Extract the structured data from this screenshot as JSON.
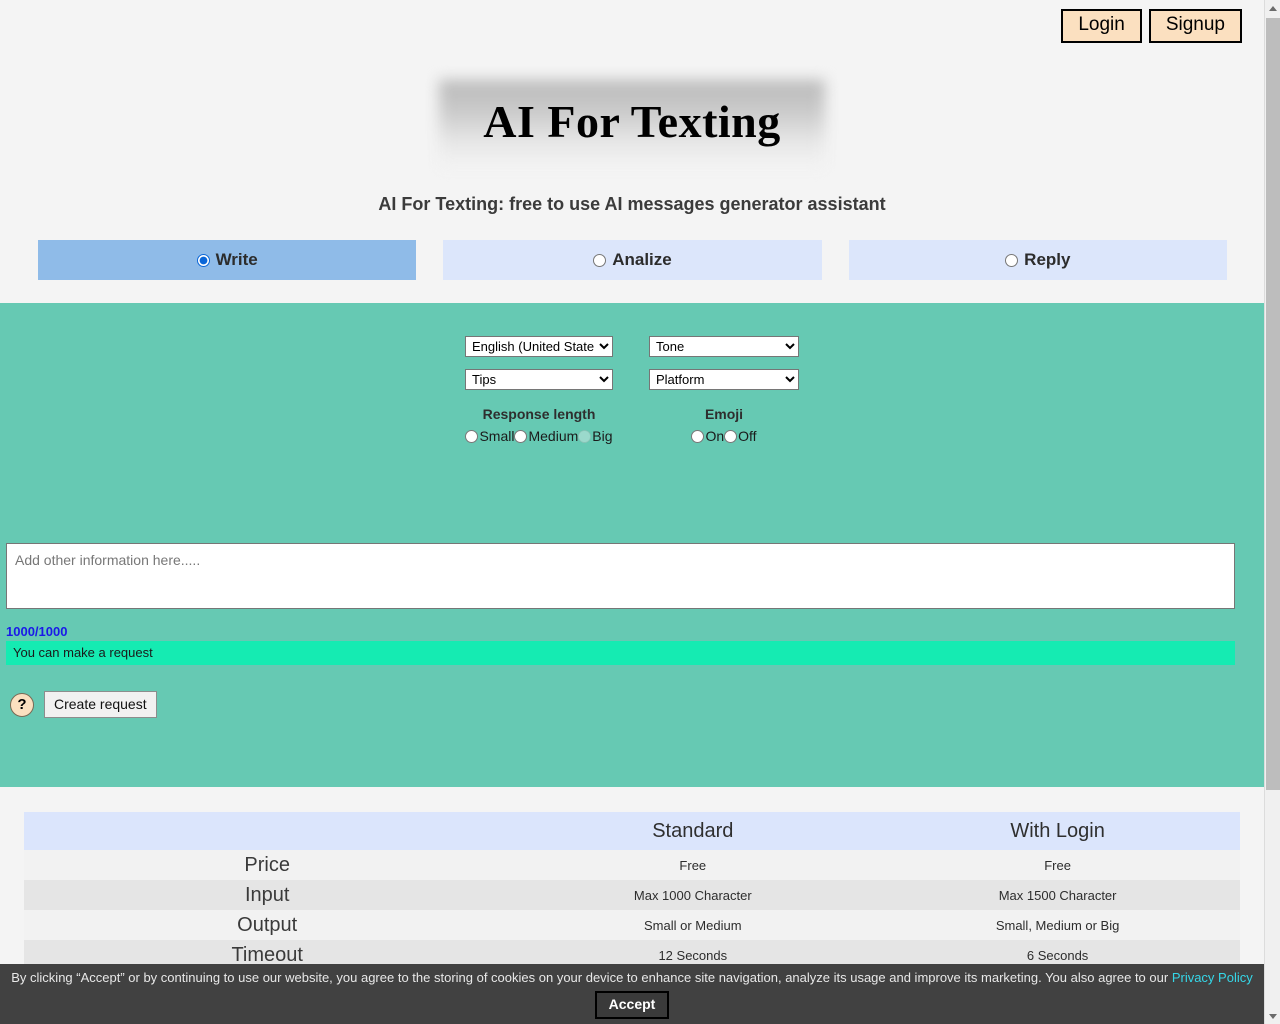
{
  "auth": {
    "login_label": "Login",
    "signup_label": "Signup"
  },
  "hero": {
    "title": "AI For Texting",
    "subtitle": "AI For Texting: free to use AI messages generator assistant"
  },
  "tabs": [
    {
      "label": "Write",
      "selected": true,
      "name": "tab-write"
    },
    {
      "label": "Analize",
      "selected": false,
      "name": "tab-analize"
    },
    {
      "label": "Reply",
      "selected": false,
      "name": "tab-reply"
    }
  ],
  "form": {
    "language_select": {
      "value": "English (United States)",
      "options": [
        "English (United States)"
      ]
    },
    "tone_select": {
      "value": "Tone",
      "options": [
        "Tone"
      ]
    },
    "tips_select": {
      "value": "Tips",
      "options": [
        "Tips"
      ]
    },
    "platform_select": {
      "value": "Platform",
      "options": [
        "Platform"
      ]
    },
    "response_length": {
      "title": "Response length",
      "options": [
        {
          "label": "Small",
          "selected": false,
          "disabled": false
        },
        {
          "label": "Medium",
          "selected": false,
          "disabled": false
        },
        {
          "label": "Big",
          "selected": false,
          "disabled": true
        }
      ]
    },
    "emoji": {
      "title": "Emoji",
      "options": [
        {
          "label": "On",
          "selected": false,
          "disabled": false
        },
        {
          "label": "Off",
          "selected": false,
          "disabled": false
        }
      ]
    },
    "textarea": {
      "placeholder": "Add other information here.....",
      "value": ""
    },
    "counter": "1000/1000",
    "status": "You can make a request",
    "help_icon_glyph": "?",
    "create_button": "Create request"
  },
  "comparison": {
    "headers": [
      "",
      "Standard",
      "With Login"
    ],
    "rows": [
      {
        "feature": "Price",
        "standard": "Free",
        "with_login": "Free"
      },
      {
        "feature": "Input",
        "standard": "Max 1000 Character",
        "with_login": "Max 1500 Character"
      },
      {
        "feature": "Output",
        "standard": "Small or Medium",
        "with_login": "Small, Medium or Big"
      },
      {
        "feature": "Timeout",
        "standard": "12 Seconds",
        "with_login": "6 Seconds"
      }
    ]
  },
  "cookie": {
    "text": "By clicking “Accept” or by continuing to use our website, you agree to the storing of cookies on your device to enhance site navigation, analyze its usage and improve its marketing. You also agree to our ",
    "link_label": "Privacy Policy",
    "accept_label": "Accept"
  },
  "colors": {
    "panel_teal": "#66c9b3",
    "status_green": "#15ebb2",
    "tab_active": "#8fbbe8",
    "tab_inactive": "#dce6fb",
    "auth_button": "#fbe0c0",
    "counter_blue": "#1a19e8",
    "link_cyan": "#35d7e8",
    "cookie_bar": "#414141"
  }
}
